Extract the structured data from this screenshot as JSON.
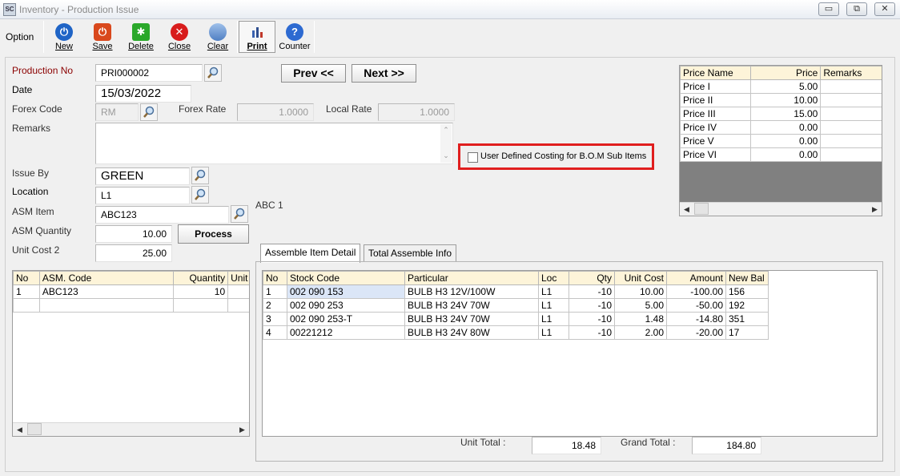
{
  "window": {
    "title": "Inventory - Production Issue",
    "icon_text": "SC",
    "controls": {
      "minimize": "▭",
      "restore": "⧉",
      "close": "✕"
    }
  },
  "toolbar": {
    "option_label": "Option",
    "buttons": [
      {
        "label": "New",
        "icon": "power-icon",
        "color": "#1f64c6"
      },
      {
        "label": "Save",
        "icon": "power-icon",
        "color": "#d9481c"
      },
      {
        "label": "Delete",
        "icon": "asterisk-icon",
        "color": "#2aa82a"
      },
      {
        "label": "Close",
        "icon": "close-icon",
        "color": "#d81c1c"
      },
      {
        "label": "Clear",
        "icon": "clear-icon",
        "color": "#5b8ac9"
      },
      {
        "label": "Print",
        "icon": "chart-icon",
        "color": "#3a62b0"
      },
      {
        "label": "Counter",
        "icon": "help-icon",
        "color": "#2d6ad1"
      }
    ]
  },
  "form": {
    "production_no_label": "Production No",
    "production_no": "PRI000002",
    "date_label": "Date",
    "date": "15/03/2022",
    "forex_code_label": "Forex Code",
    "forex_code": "RM",
    "forex_rate_label": "Forex Rate",
    "forex_rate": "1.0000",
    "local_rate_label": "Local Rate",
    "local_rate": "1.0000",
    "remarks_label": "Remarks",
    "remarks": "",
    "issue_by_label": "Issue By",
    "issue_by": "GREEN",
    "location_label": "Location",
    "location": "L1",
    "asm_item_label": "ASM Item",
    "asm_item": "ABC123",
    "asm_item_desc": "ABC 1",
    "asm_quantity_label": "ASM Quantity",
    "asm_quantity": "10.00",
    "unit_cost2_label": "Unit Cost 2",
    "unit_cost2": "25.00",
    "process_label": "Process",
    "prev_label": "Prev <<",
    "next_label": "Next >>",
    "user_defined_costing_label": "User Defined Costing for B.O.M Sub Items",
    "user_defined_costing_checked": false
  },
  "price_grid": {
    "columns": [
      "Price Name",
      "Price",
      "Remarks"
    ],
    "rows": [
      [
        "Price I",
        "5.00",
        ""
      ],
      [
        "Price II",
        "10.00",
        ""
      ],
      [
        "Price III",
        "15.00",
        ""
      ],
      [
        "Price IV",
        "0.00",
        ""
      ],
      [
        "Price V",
        "0.00",
        ""
      ],
      [
        "Price VI",
        "0.00",
        ""
      ]
    ]
  },
  "asm_grid": {
    "columns": [
      "No",
      "ASM. Code",
      "Quantity",
      "Unit"
    ],
    "rows": [
      [
        "1",
        "ABC123",
        "10",
        ""
      ],
      [
        "",
        "",
        "",
        ""
      ]
    ]
  },
  "tabs": [
    {
      "label": "Assemble Item Detail",
      "active": true
    },
    {
      "label": "Total Assemble Info",
      "active": false
    }
  ],
  "detail_grid": {
    "columns": [
      "No",
      "Stock Code",
      "Particular",
      "Loc",
      "Qty",
      "Unit Cost",
      "Amount",
      "New Bal"
    ],
    "rows": [
      [
        "1",
        "002 090 153",
        "BULB H3 12V/100W",
        "L1",
        "-10",
        "10.00",
        "-100.00",
        "156"
      ],
      [
        "2",
        "002 090 253",
        "BULB H3 24V 70W",
        "L1",
        "-10",
        "5.00",
        "-50.00",
        "192"
      ],
      [
        "3",
        "002 090 253-T",
        "BULB H3 24V 70W",
        "L1",
        "-10",
        "1.48",
        "-14.80",
        "351"
      ],
      [
        "4",
        "00221212",
        "BULB H3 24V 80W",
        "L1",
        "-10",
        "2.00",
        "-20.00",
        "17"
      ]
    ]
  },
  "totals": {
    "unit_total_label": "Unit Total :",
    "unit_total": "18.48",
    "grand_total_label": "Grand Total :",
    "grand_total": "184.80"
  }
}
